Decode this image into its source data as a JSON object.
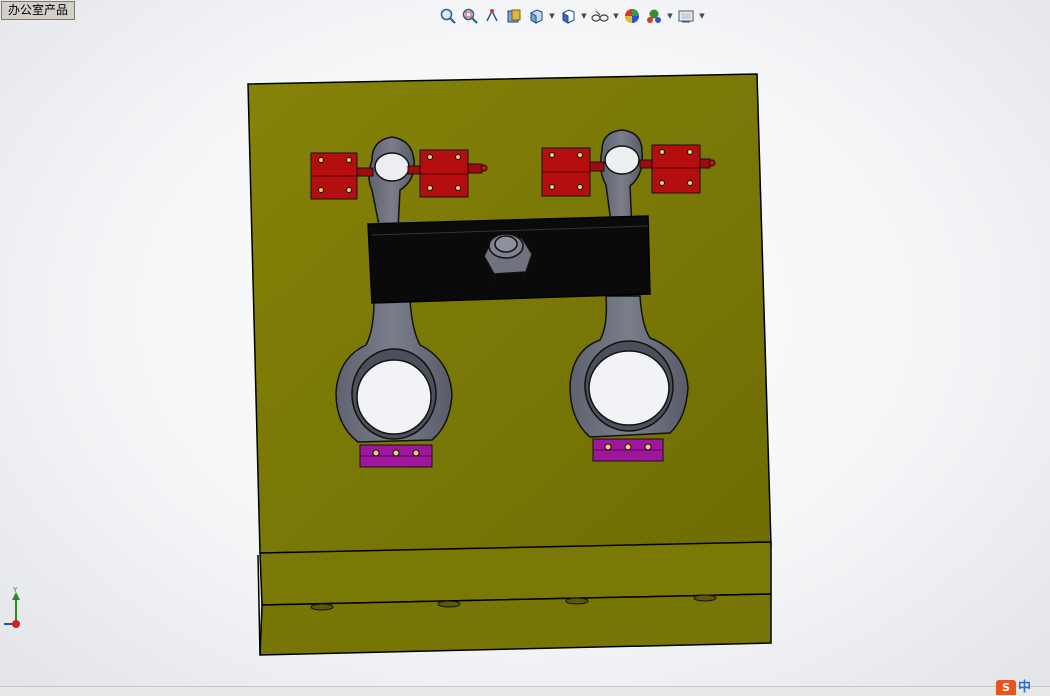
{
  "document": {
    "tab_title": "办公室产品"
  },
  "toolbar": {
    "icons": [
      "zoom-to-fit-icon",
      "zoom-to-area-icon",
      "previous-view-icon",
      "section-view-icon",
      "view-orientation-icon",
      "display-style-icon",
      "hide-show-items-icon",
      "edit-appearance-icon",
      "apply-scene-icon",
      "view-settings-icon"
    ]
  },
  "triad": {
    "y_label": "Y"
  },
  "ime": {
    "label": "中",
    "logo": "S"
  },
  "colors": {
    "base_plate": "#7f7d05",
    "clamp_red": "#b40e0e",
    "clamp_purple": "#a0179e",
    "rod_gray": "#6a6e7b",
    "bridge_black": "#0a0a0a"
  }
}
